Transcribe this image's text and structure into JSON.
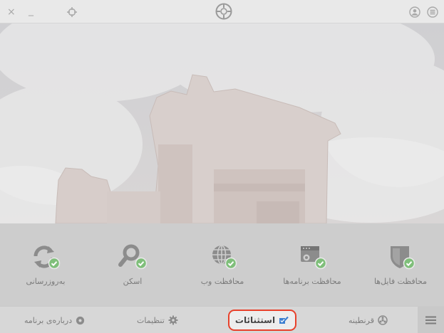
{
  "colors": {
    "check": "#7fbf7a",
    "icon": "#8c8c8c",
    "highlight": "#e8412b",
    "accent_blue": "#3d7fd0"
  },
  "titlebar": {
    "close_label": "×",
    "minimize_label": "_",
    "icons": [
      "close-icon",
      "minimize-icon",
      "target-icon",
      "app-logo",
      "user-icon",
      "hamburger-menu-icon"
    ]
  },
  "features": [
    {
      "label": "به‌روزرسانی",
      "icon": "refresh-icon"
    },
    {
      "label": "اسکن",
      "icon": "search-icon"
    },
    {
      "label": "محافظت وب",
      "icon": "globe-icon"
    },
    {
      "label": "محافظت برنامه‌ها",
      "icon": "app-protection-icon"
    },
    {
      "label": "محافظت فایل‌ها",
      "icon": "shield-icon"
    }
  ],
  "bottombar": {
    "about_label": "درباره‌ی برنامه",
    "settings_label": "تنظیمات",
    "exceptions_label": "استثنائات",
    "quarantine_label": "قرنطینه",
    "icons": [
      "info-icon",
      "gear-icon",
      "exceptions-icon",
      "quarantine-icon",
      "menu-icon"
    ]
  }
}
